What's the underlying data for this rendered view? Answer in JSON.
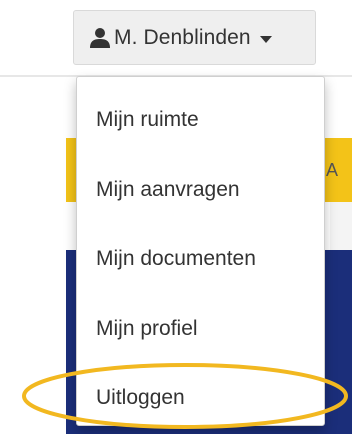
{
  "user_menu": {
    "user_name": "M. Denblinden",
    "user_icon": "user-icon",
    "caret_icon": "caret-down-icon"
  },
  "menu": {
    "items": [
      {
        "label": "Mijn ruimte"
      },
      {
        "label": "Mijn aanvragen"
      },
      {
        "label": "Mijn documenten"
      },
      {
        "label": "Mijn profiel"
      },
      {
        "label": "Uitloggen"
      }
    ]
  },
  "background": {
    "partial_text": "A",
    "accent_yellow": "#f3c318",
    "accent_navy": "#1b2e7a"
  },
  "annotation": {
    "highlight_color": "#f2b820",
    "highlighted_item": "Uitloggen"
  }
}
